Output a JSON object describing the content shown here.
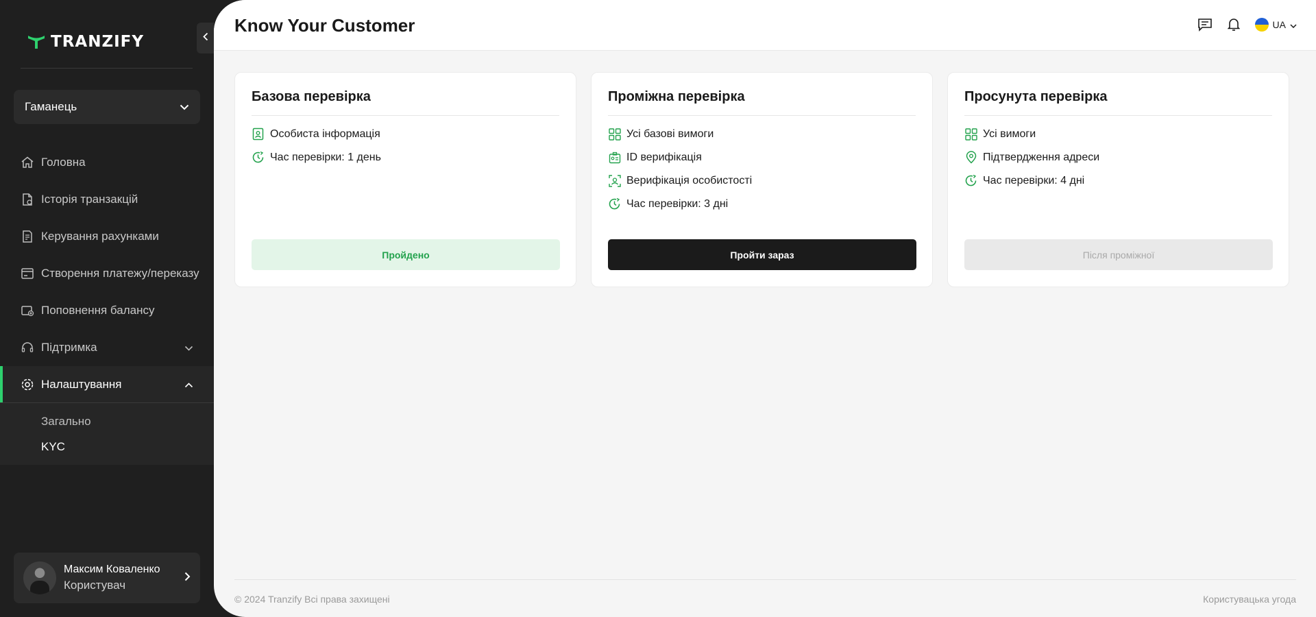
{
  "app": {
    "logo_text": "TRANZIFY"
  },
  "sidebar": {
    "wallet_select": {
      "value": "Гаманець"
    },
    "nav": [
      {
        "label": "Головна",
        "icon": "home-icon"
      },
      {
        "label": "Історія транзакцій",
        "icon": "document-icon"
      },
      {
        "label": "Керування рахунками",
        "icon": "accounts-icon"
      },
      {
        "label": "Створення платежу/переказу",
        "icon": "payment-icon"
      },
      {
        "label": "Поповнення балансу",
        "icon": "wallet-topup-icon"
      },
      {
        "label": "Підтримка",
        "icon": "headset-icon"
      },
      {
        "label": "Налаштування",
        "icon": "gear-icon"
      }
    ],
    "settings_sub": [
      {
        "label": "Загально"
      },
      {
        "label": "KYC"
      }
    ],
    "user": {
      "name": "Максим Коваленко",
      "role": "Користувач"
    }
  },
  "header": {
    "title": "Know Your Customer",
    "language": "UA"
  },
  "cards": [
    {
      "title": "Базова перевірка",
      "features": [
        {
          "text": "Особиста інформація",
          "icon": "id-card-icon"
        },
        {
          "text": "Час перевірки: 1 день",
          "icon": "clock-icon"
        }
      ],
      "button": "Пройдено",
      "status": "passed"
    },
    {
      "title": "Проміжна перевірка",
      "features": [
        {
          "text": "Усі базові вимоги",
          "icon": "grid-icon"
        },
        {
          "text": "ID верифікація",
          "icon": "id-badge-icon"
        },
        {
          "text": "Верифікація особистості",
          "icon": "face-scan-icon"
        },
        {
          "text": "Час перевірки: 3 дні",
          "icon": "clock-icon"
        }
      ],
      "button": "Пройти зараз",
      "status": "available"
    },
    {
      "title": "Просунута перевірка",
      "features": [
        {
          "text": "Усі вимоги",
          "icon": "grid-icon"
        },
        {
          "text": "Підтвердження адреси",
          "icon": "location-pin-icon"
        },
        {
          "text": "Час перевірки: 4 дні",
          "icon": "clock-icon"
        }
      ],
      "button": "Після проміжної",
      "status": "locked"
    }
  ],
  "footer": {
    "copyright": "© 2024 Tranzify Всі права захищені",
    "terms_link": "Користувацька угода"
  },
  "colors": {
    "accent_green": "#2ed06e",
    "sidebar_bg": "#1f1f1f",
    "primary_button": "#1b1b1b",
    "passed_bg": "#e3f5e8",
    "passed_text": "#23a24d"
  }
}
